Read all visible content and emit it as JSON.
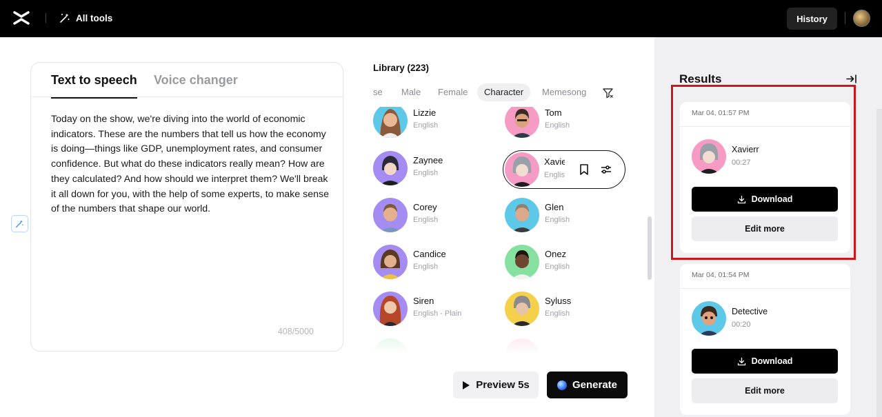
{
  "topbar": {
    "logo_icon": "capcut-logo-icon",
    "all_tools_label": "All tools",
    "history_label": "History"
  },
  "editor": {
    "tabs": [
      {
        "label": "Text to speech",
        "active": true
      },
      {
        "label": "Voice changer",
        "active": false
      }
    ],
    "text": "Today on the show, we're diving into the world of economic indicators. These are the numbers that tell us how the economy is doing—things like GDP, unemployment rates, and consumer confidence. But what do these indicators really mean? How are they calculated? And how should we interpret them? We'll break it all down for you, with the help of some experts, to make sense of the numbers that shape our world.",
    "counter": "408/5000"
  },
  "library": {
    "title": "Library (223)",
    "filters": [
      {
        "label": "se",
        "selected": false
      },
      {
        "label": "Male",
        "selected": false
      },
      {
        "label": "Female",
        "selected": false
      },
      {
        "label": "Character",
        "selected": true
      },
      {
        "label": "Memesong",
        "selected": false
      }
    ],
    "voices": [
      {
        "name": "Lizzie",
        "lang": "English",
        "color": "#5ec8e8"
      },
      {
        "name": "Tom",
        "lang": "English",
        "color": "#f59bc4"
      },
      {
        "name": "Zaynee",
        "lang": "English",
        "color": "#a58cf2"
      },
      {
        "name": "Xavierr",
        "lang": "English",
        "color": "#f59bc4",
        "selected": true
      },
      {
        "name": "Corey",
        "lang": "English",
        "color": "#a58cf2"
      },
      {
        "name": "Glen",
        "lang": "English",
        "color": "#5ec8e8"
      },
      {
        "name": "Candice",
        "lang": "English",
        "color": "#a58cf2"
      },
      {
        "name": "Onez",
        "lang": "English",
        "color": "#86e0a0"
      },
      {
        "name": "Siren",
        "lang": "English - Plain",
        "color": "#a58cf2"
      },
      {
        "name": "Syluss",
        "lang": "English",
        "color": "#f5d04a"
      }
    ]
  },
  "actions": {
    "preview_label": "Preview 5s",
    "generate_label": "Generate"
  },
  "results": {
    "title": "Results",
    "items": [
      {
        "date": "Mar 04, 01:57 PM",
        "name": "Xavierr",
        "duration": "00:27",
        "download_label": "Download",
        "edit_label": "Edit more",
        "color": "#f59bc4"
      },
      {
        "date": "Mar 04, 01:54 PM",
        "name": "Detective",
        "duration": "00:20",
        "download_label": "Download",
        "edit_label": "Edit more",
        "color": "#5ec8e8"
      }
    ]
  },
  "colors": {
    "accent_dark": "#000000",
    "highlight_border": "#d0141c"
  }
}
